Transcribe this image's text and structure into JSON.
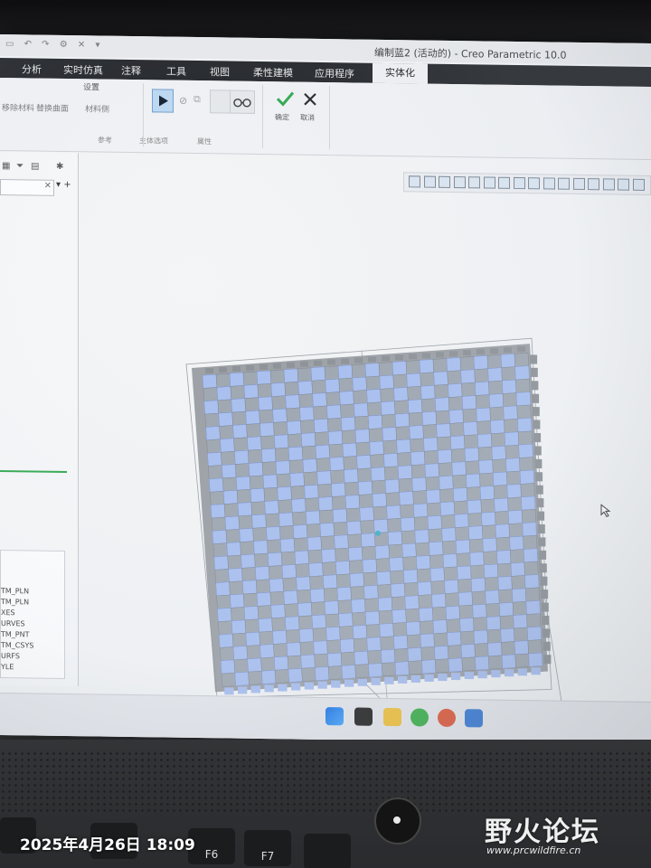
{
  "window": {
    "title": "编制蓝2 (活动的) - Creo Parametric 10.0"
  },
  "tabs": [
    {
      "label": "分析"
    },
    {
      "label": "实时仿真"
    },
    {
      "label": "注释"
    },
    {
      "label": "工具"
    },
    {
      "label": "视图"
    },
    {
      "label": "柔性建模"
    },
    {
      "label": "应用程序"
    },
    {
      "label": "实体化"
    }
  ],
  "ribbon": {
    "settings_label": "设置",
    "remove_material": "移除材料",
    "replace_surface": "替换曲面",
    "material_side": "材料侧",
    "group_reference": "参考",
    "group_body_options": "主体选项",
    "group_properties": "属性",
    "confirm_label": "确定",
    "cancel_label": "取消"
  },
  "left_panel": {
    "layer_items": [
      "TM_PLN",
      "TM_PLN",
      "XES",
      "URVES",
      "TM_PNT",
      "TM_CSYS",
      "URFS",
      "YLE"
    ]
  },
  "overlay": {
    "timestamp": "2025年4月26日 18:09",
    "watermark": "野火论坛",
    "watermark_url": "www.prcwildfire.cn"
  },
  "keyboard": {
    "keys": [
      "F6",
      "F7"
    ]
  },
  "colors": {
    "weave_blue": "#a8bff0",
    "weave_gray": "#8c9196",
    "confirm_green": "#2aa84a"
  }
}
